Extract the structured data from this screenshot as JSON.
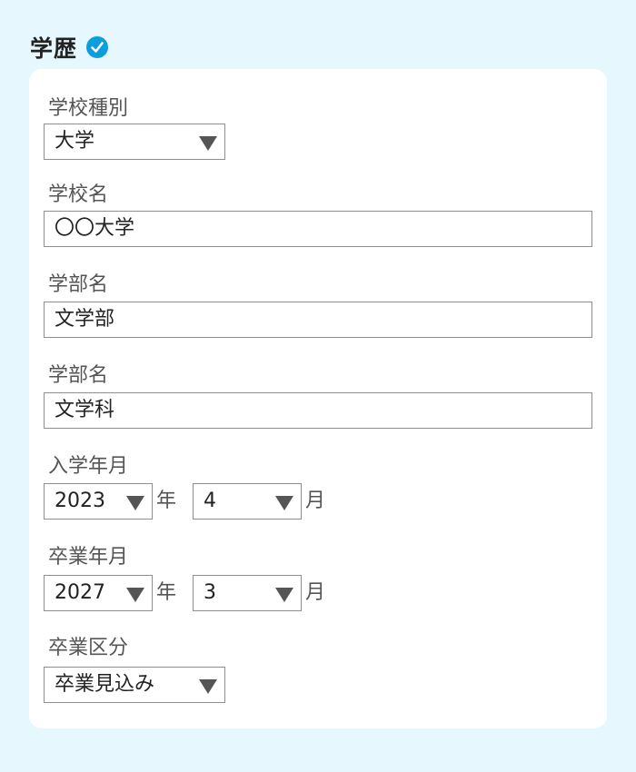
{
  "section": {
    "title": "学歴",
    "verified_icon": "check-circle-icon",
    "accent_color": "#0a9fdc"
  },
  "fields": {
    "school_type": {
      "label": "学校種別",
      "value": "大学"
    },
    "school_name": {
      "label": "学校名",
      "value": "〇〇大学"
    },
    "faculty": {
      "label": "学部名",
      "value": "文学部"
    },
    "department": {
      "label": "学部名",
      "value": "文学科"
    },
    "admission": {
      "label": "入学年月",
      "year": "2023",
      "year_unit": "年",
      "month": "4",
      "month_unit": "月"
    },
    "graduation": {
      "label": "卒業年月",
      "year": "2027",
      "year_unit": "年",
      "month": "3",
      "month_unit": "月"
    },
    "graduation_status": {
      "label": "卒業区分",
      "value": "卒業見込み"
    }
  }
}
